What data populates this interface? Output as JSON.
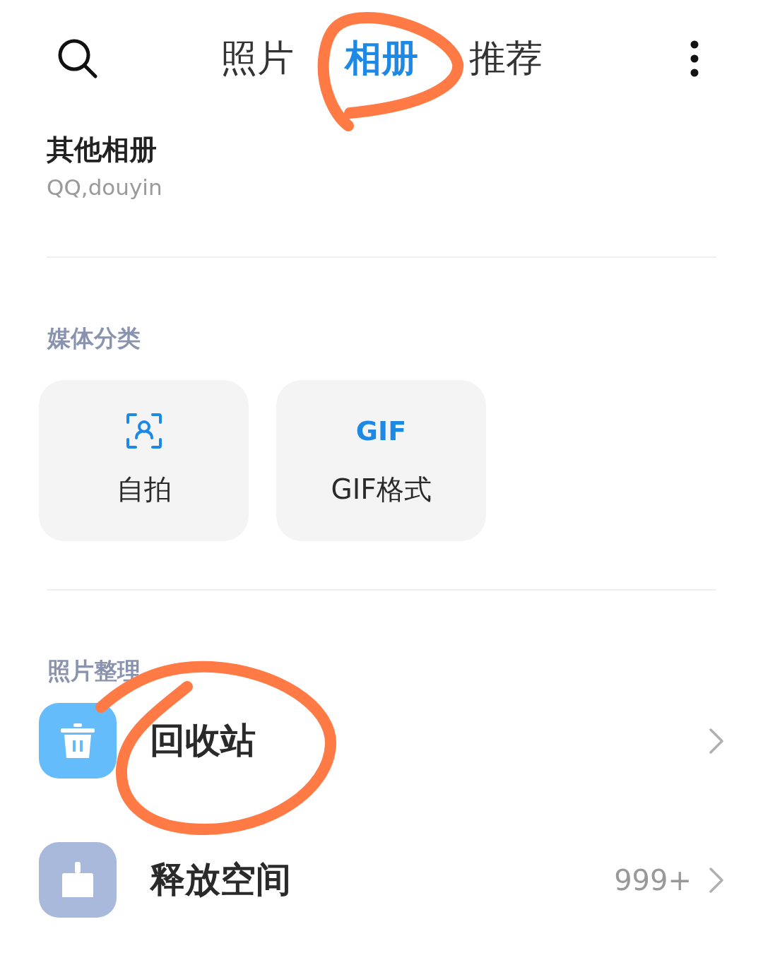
{
  "header": {
    "tabs": [
      {
        "label": "照片",
        "selected": false,
        "circled": false
      },
      {
        "label": "相册",
        "selected": true,
        "circled": true
      },
      {
        "label": "推荐",
        "selected": false,
        "circled": false
      }
    ]
  },
  "other_albums": {
    "title": "其他相册",
    "subtitle": "QQ,douyin"
  },
  "media_section": {
    "title": "媒体分类",
    "cards": [
      {
        "kind": "selfie",
        "label": "自拍"
      },
      {
        "kind": "gif",
        "badge": "GIF",
        "label": "GIF格式"
      }
    ]
  },
  "organize_section": {
    "title": "照片整理",
    "rows": [
      {
        "kind": "trash",
        "label": "回收站",
        "circled": true
      },
      {
        "kind": "clean",
        "label": "释放空间",
        "count": "999+",
        "circled": false
      }
    ]
  }
}
